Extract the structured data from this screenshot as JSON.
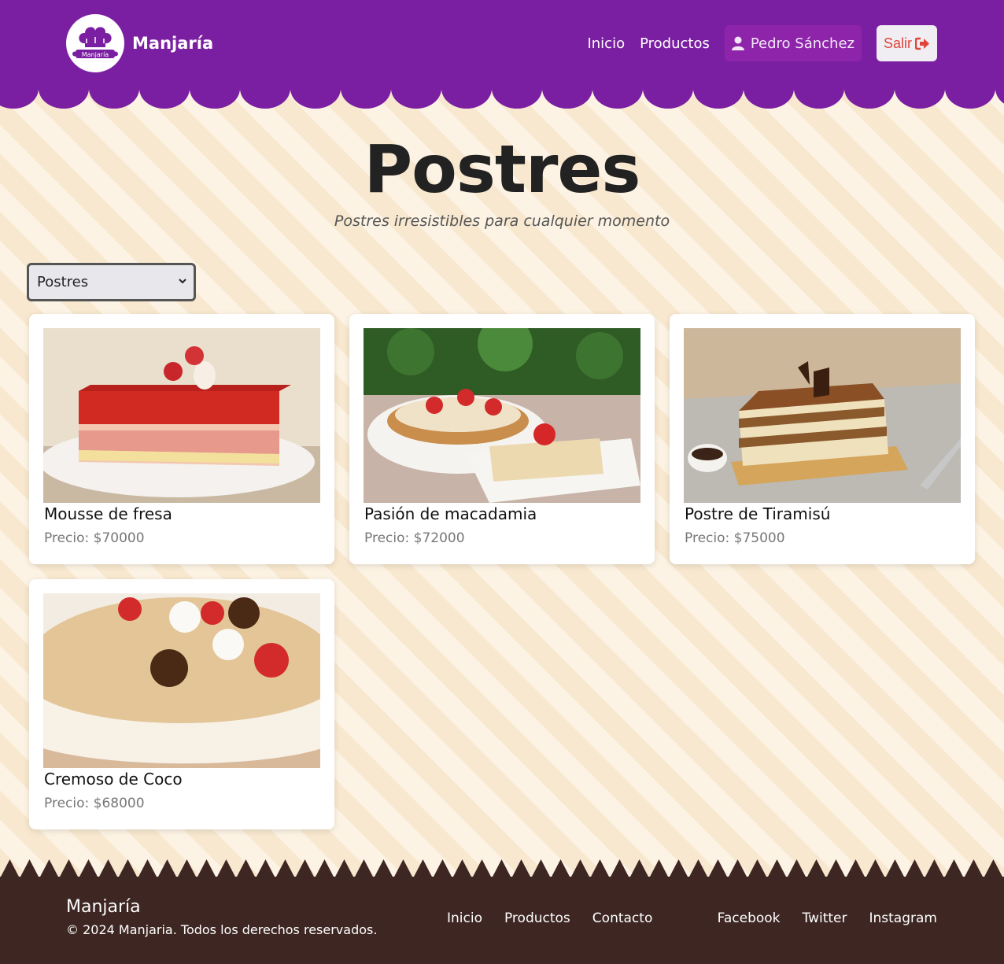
{
  "header": {
    "logo_text": "Manjaría",
    "brand": "Manjaría",
    "nav": {
      "inicio": "Inicio",
      "productos": "Productos"
    },
    "user_name": "Pedro Sánchez",
    "logout_label": "Salir"
  },
  "hero": {
    "title": "Postres",
    "subtitle": "Postres irresistibles para cualquier momento"
  },
  "category_select": {
    "selected": "Postres"
  },
  "products": [
    {
      "name": "Mousse de fresa",
      "price": "Precio: $70000"
    },
    {
      "name": "Pasión de macadamia",
      "price": "Precio: $72000"
    },
    {
      "name": "Postre de Tiramisú",
      "price": "Precio: $75000"
    },
    {
      "name": "Cremoso de Coco",
      "price": "Precio: $68000"
    }
  ],
  "footer": {
    "brand": "Manjaría",
    "copyright": "© 2024 Manjaria. Todos los derechos reservados.",
    "links": [
      "Inicio",
      "Productos",
      "Contacto"
    ],
    "social": [
      "Facebook",
      "Twitter",
      "Instagram"
    ]
  },
  "colors": {
    "header_purple": "#7b1fa2",
    "footer_brown": "#3e2723",
    "logout_red": "#e0443b"
  }
}
